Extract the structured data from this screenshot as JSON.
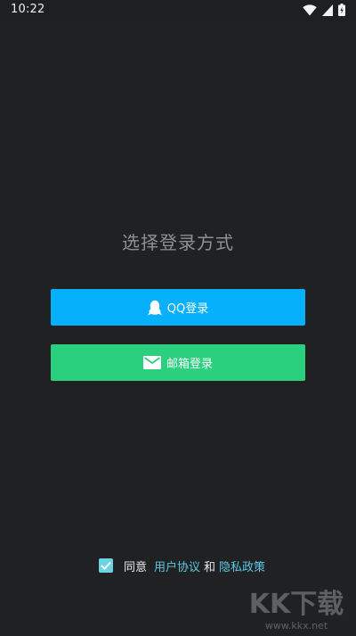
{
  "status_bar": {
    "time": "10:22",
    "icons": [
      "wifi-icon",
      "cellular-icon",
      "battery-icon"
    ]
  },
  "page": {
    "title": "选择登录方式"
  },
  "buttons": {
    "qq": {
      "label": "QQ登录",
      "icon": "qq-penguin-icon",
      "color": "#06b0fb"
    },
    "email": {
      "label": "邮箱登录",
      "icon": "envelope-icon",
      "color": "#2ad07d"
    }
  },
  "agreement": {
    "checked": true,
    "prefix": "同意",
    "user_agreement": "用户协议",
    "conjunction": "和",
    "privacy_policy": "隐私政策",
    "link_color": "#5ec7e2"
  },
  "watermark": {
    "text": "KK下载",
    "site": "www.kkx.net"
  }
}
